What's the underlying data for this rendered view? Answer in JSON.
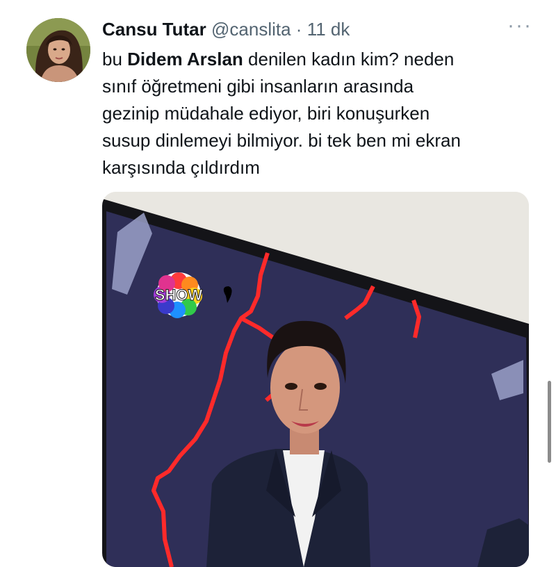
{
  "tweet": {
    "author": {
      "display_name": "Cansu Tutar",
      "handle": "@canslita",
      "separator": "·",
      "time": "11 dk",
      "more_icon": "more-horizontal-icon"
    },
    "text": {
      "prefix": "bu ",
      "mention": "Didem Arslan",
      "line1_rest": " denilen kadın kim? neden",
      "line2": "sınıf öğretmeni gibi insanların arasında",
      "line3": "gezinip müdahale ediyor, biri konuşurken",
      "line4": "susup dinlemeyi bilmiyor. bi tek ben mi ekran",
      "line5": "karşısında çıldırdım"
    },
    "media": {
      "channel_logo_text": "SHOW",
      "colors": {
        "studio_wall": "#e9e7e1",
        "screen_bg": "#2f2f58",
        "map_lines": "#ff2a2a"
      }
    }
  }
}
